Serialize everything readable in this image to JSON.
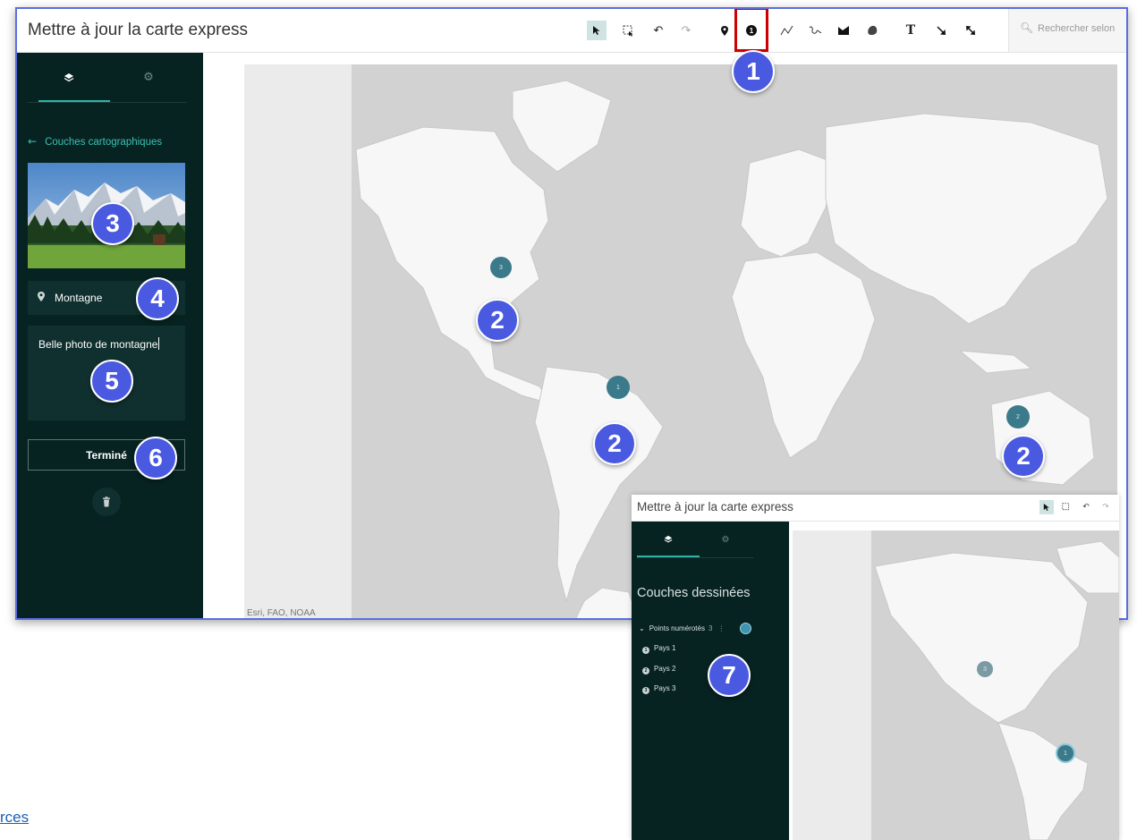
{
  "main": {
    "title": "Mettre à jour la carte express",
    "search_placeholder": "Rechercher selon",
    "toolbar": [
      "select-pointer",
      "select-box",
      "undo",
      "redo",
      "point",
      "numbered-point",
      "line",
      "freehand",
      "area",
      "freehand-area",
      "text",
      "arrow",
      "double-arrow"
    ],
    "sidebar": {
      "back_label": "Couches cartographiques",
      "name_value": "Montagne",
      "description_value": "Belle photo de montagne",
      "done_label": "Terminé"
    },
    "map_credit": "Esri, FAO, NOAA",
    "clusters": [
      {
        "label": "3",
        "region": "United States"
      },
      {
        "label": "1",
        "region": "Brazil"
      },
      {
        "label": "2",
        "region": "Australia"
      }
    ]
  },
  "inset": {
    "title": "Mettre à jour la carte express",
    "heading": "Couches dessinées",
    "layer_name": "Points numérotés",
    "layer_count": "3",
    "items": [
      {
        "num": "1",
        "label": "Pays 1"
      },
      {
        "num": "2",
        "label": "Pays 2"
      },
      {
        "num": "3",
        "label": "Pays 3"
      }
    ],
    "clusters": [
      {
        "label": "3",
        "region": "United States"
      },
      {
        "label": "1",
        "region": "Brazil"
      }
    ]
  },
  "callouts": {
    "c1": "1",
    "c2a": "2",
    "c2b": "2",
    "c2c": "2",
    "c3": "3",
    "c4": "4",
    "c5": "5",
    "c6": "6",
    "c7": "7"
  },
  "link_text": "rces",
  "colors": {
    "sidebar_bg": "#062321",
    "accent": "#2fb4a6",
    "callout": "#4a5ae0",
    "cluster": "#3a7a8a",
    "highlight": "#cc0000"
  }
}
